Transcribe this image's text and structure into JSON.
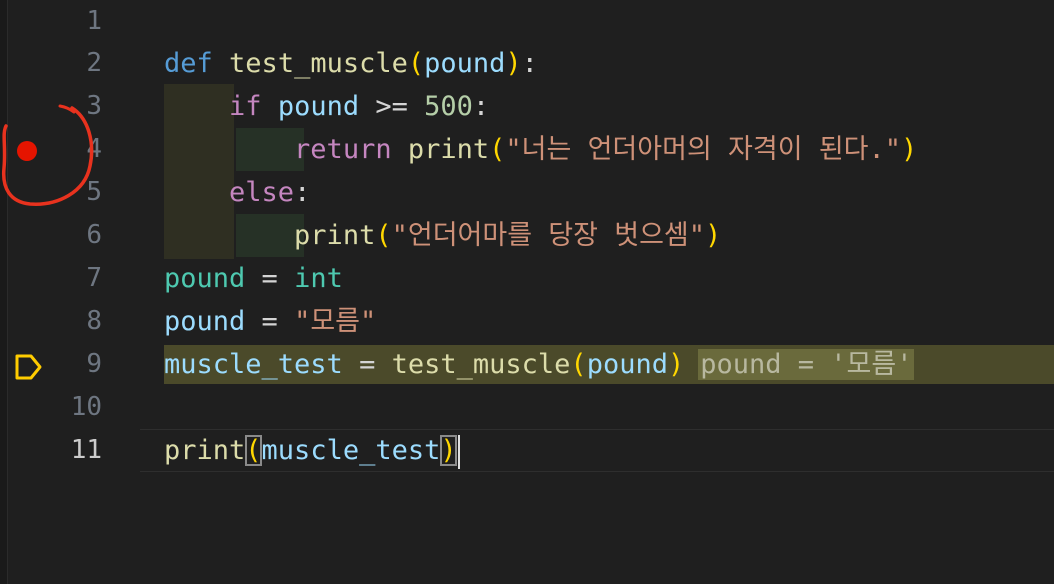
{
  "lines": [
    {
      "num": "1"
    },
    {
      "num": "2",
      "tokens": {
        "t1": "def",
        "t2": "test_muscle",
        "t3": "(",
        "t4": "pound",
        "t5": ")",
        "t6": ":"
      }
    },
    {
      "num": "3",
      "tokens": {
        "t1": "if",
        "t2": "pound",
        "t3": ">=",
        "t4": "500",
        "t5": ":"
      }
    },
    {
      "num": "4",
      "tokens": {
        "t1": "return",
        "t2": "print",
        "t3": "(",
        "t4": "\"너는 언더아머의 자격이 된다.\"",
        "t5": ")"
      }
    },
    {
      "num": "5",
      "tokens": {
        "t1": "else",
        "t2": ":"
      }
    },
    {
      "num": "6",
      "tokens": {
        "t1": "print",
        "t2": "(",
        "t3": "\"언더어마를 당장 벗으셈\"",
        "t4": ")"
      }
    },
    {
      "num": "7",
      "tokens": {
        "t1": "pound",
        "t2": "=",
        "t3": "int"
      }
    },
    {
      "num": "8",
      "tokens": {
        "t1": "pound",
        "t2": "=",
        "t3": "\"모름\""
      }
    },
    {
      "num": "9",
      "tokens": {
        "t1": "muscle_test",
        "t2": "=",
        "t3": "test_muscle",
        "t4": "(",
        "t5": "pound",
        "t6": ")"
      },
      "inline_value": "pound = '모름'"
    },
    {
      "num": "10"
    },
    {
      "num": "11",
      "tokens": {
        "t1": "print",
        "t2": "(",
        "t3": "muscle_test",
        "t4": ")"
      }
    }
  ],
  "colors": {
    "breakpoint": "#e51400",
    "debug_stop": "#ffcc00",
    "annotation": "#e8321e",
    "highlight": "#4b4a2a"
  },
  "icons": {
    "breakpoint": "breakpoint-dot",
    "debug": "debug-stackframe-arrow",
    "annotation": "hand-drawn-circle"
  }
}
